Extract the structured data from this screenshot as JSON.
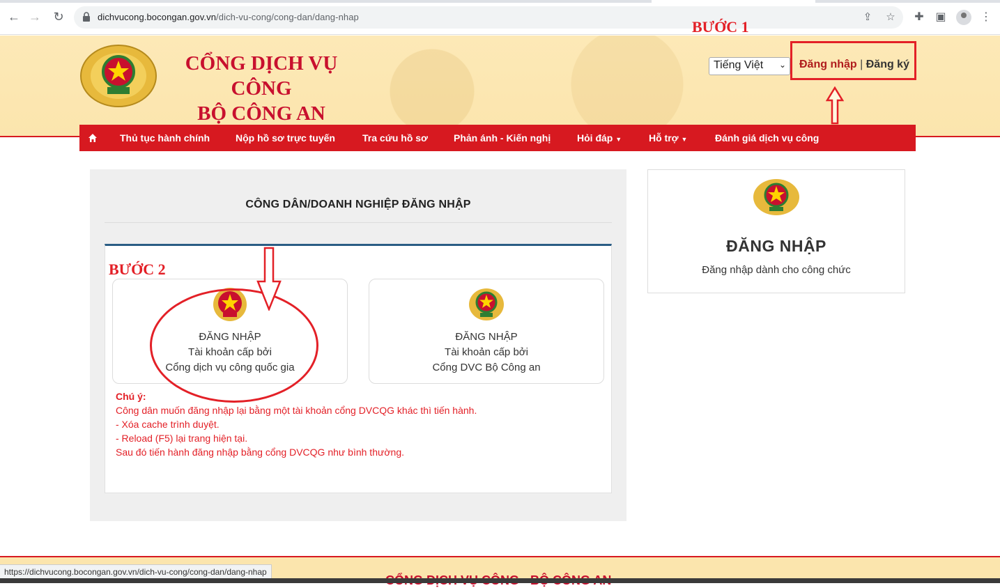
{
  "browser": {
    "url_host": "dichvucong.bocongan.gov.vn",
    "url_path": "/dich-vu-cong/cong-dan/dang-nhap",
    "status_url": "https://dichvucong.bocongan.gov.vn/dich-vu-cong/cong-dan/dang-nhap"
  },
  "header": {
    "title_line1": "CỔNG DỊCH VỤ CÔNG",
    "title_line2": "BỘ CÔNG AN",
    "language": "Tiếng Việt",
    "login_link": "Đăng nhập",
    "separator": "|",
    "register_link": "Đăng ký",
    "step1_label": "BƯỚC 1"
  },
  "nav": {
    "items": [
      "Thủ tục hành chính",
      "Nộp hồ sơ trực tuyến",
      "Tra cứu hồ sơ",
      "Phản ánh - Kiến nghị",
      "Hỏi đáp",
      "Hỗ trợ",
      "Đánh giá dịch vụ công"
    ]
  },
  "main": {
    "title": "CÔNG DÂN/DOANH NGHIỆP ĐĂNG NHẬP",
    "step2_label": "BƯỚC 2",
    "options": [
      {
        "line1": "ĐĂNG NHẬP",
        "line2": "Tài khoản cấp bởi",
        "line3": "Cổng dịch vụ công quốc gia"
      },
      {
        "line1": "ĐĂNG NHẬP",
        "line2": "Tài khoản cấp bởi",
        "line3": "Cổng DVC Bộ Công an"
      }
    ],
    "note": {
      "label": "Chú ý:",
      "lines": [
        "Công dân muốn đăng nhập lại bằng một tài khoản cổng DVCQG khác thì tiến hành.",
        "- Xóa cache trình duyệt.",
        "- Reload (F5) lại trang hiện tại.",
        "Sau đó tiến hành đăng nhập bằng cổng DVCQG như bình thường."
      ]
    }
  },
  "right_panel": {
    "title": "ĐĂNG NHẬP",
    "subtitle": "Đăng nhập dành cho công chức"
  },
  "footer": {
    "title": "CỔNG DỊCH VỤ CÔNG - BỘ CÔNG AN"
  },
  "colors": {
    "brand_red": "#d71920",
    "header_bg": "#fbe5ad",
    "annotation_red": "#e32027",
    "card_top_border": "#2a5d84"
  }
}
